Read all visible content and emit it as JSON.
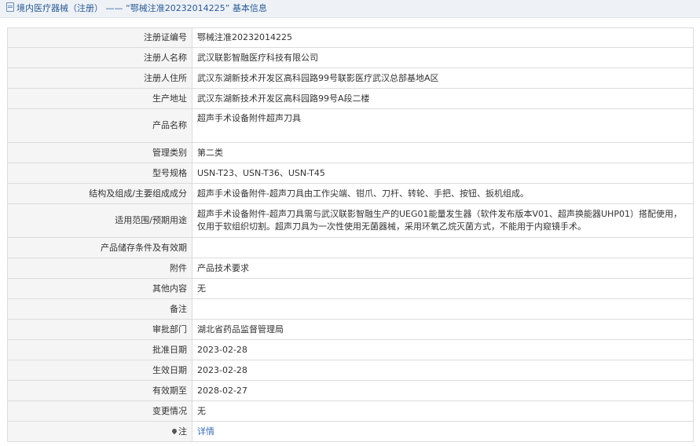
{
  "header": {
    "title": "境内医疗器械（注册） —— “鄂械注准20232014225” 基本信息",
    "icon": "document-icon"
  },
  "rows": [
    {
      "label": "注册证编号",
      "value": "鄂械注准20232014225"
    },
    {
      "label": "注册人名称",
      "value": "武汉联影智融医疗科技有限公司"
    },
    {
      "label": "注册人住所",
      "value": "武汉东湖新技术开发区高科园路99号联影医疗武汉总部基地A区"
    },
    {
      "label": "生产地址",
      "value": "武汉东湖新技术开发区高科园路99号A段二楼"
    },
    {
      "label": "产品名称",
      "value": "超声手术设备附件超声刀具"
    },
    {
      "label": "管理类别",
      "value": "第二类"
    },
    {
      "label": "型号规格",
      "value": "USN-T23、USN-T36、USN-T45"
    },
    {
      "label": "结构及组成/主要组成成分",
      "value": "超声手术设备附件-超声刀具由工作尖端、钳爪、刀杆、转轮、手把、按钮、扳机组成。"
    },
    {
      "label": "适用范围/预期用途",
      "value": "超声手术设备附件-超声刀具需与武汉联影智融生产的UEG01能量发生器（软件发布版本V01、超声换能器UHP01）搭配使用，仅用于软组织切割。超声刀具为一次性使用无菌器械，采用环氧乙烷灭菌方式，不能用于内窥镜手术。"
    },
    {
      "label": "产品储存条件及有效期",
      "value": ""
    },
    {
      "label": "附件",
      "value": "产品技术要求"
    },
    {
      "label": "其他内容",
      "value": "无"
    },
    {
      "label": "备注",
      "value": ""
    },
    {
      "label": "审批部门",
      "value": "湖北省药品监督管理局"
    },
    {
      "label": "批准日期",
      "value": "2023-02-28"
    },
    {
      "label": "生效日期",
      "value": "2023-02-28"
    },
    {
      "label": "有效期至",
      "value": "2028-02-27"
    },
    {
      "label": "变更情况",
      "value": "无"
    },
    {
      "label": "注",
      "value": "详情"
    }
  ],
  "colors": {
    "header_bg": "#eef2f7",
    "header_text": "#2b5b94",
    "label_bg": "#f5f5f5",
    "border": "#dcdcdc",
    "link": "#3a6fb5"
  }
}
